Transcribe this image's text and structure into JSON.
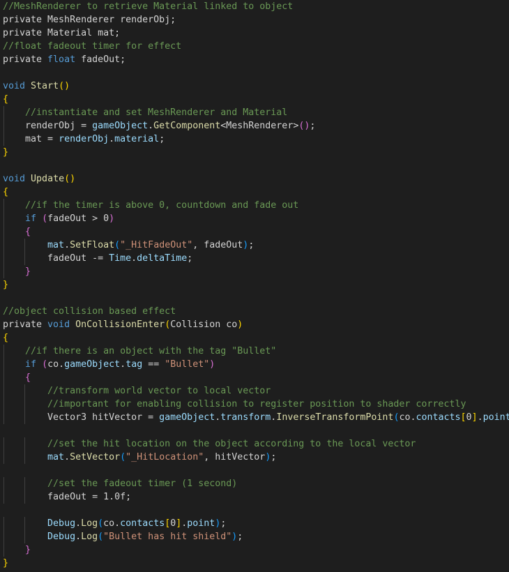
{
  "colors": {
    "background": "#1e1e1e",
    "default": "#d4d4d4",
    "comment": "#6a9955",
    "keyword": "#569cd6",
    "type": "#4ec9b0",
    "method": "#dcdcaa",
    "variable": "#9cdcfe",
    "string": "#ce9178",
    "number": "#b5cea8",
    "brace1": "#ffd700",
    "brace2": "#da70d6",
    "brace3": "#179fff"
  },
  "lines": [
    [
      [
        "comment",
        "//MeshRenderer to retrieve Material linked to object"
      ]
    ],
    [
      [
        "default",
        "private MeshRenderer renderObj;"
      ]
    ],
    [
      [
        "default",
        "private Material mat;"
      ]
    ],
    [
      [
        "comment",
        "//float fadeout timer for effect"
      ]
    ],
    [
      [
        "default",
        "private "
      ],
      [
        "keyword",
        "float"
      ],
      [
        "default",
        " fadeOut;"
      ]
    ],
    [],
    [
      [
        "keyword",
        "void"
      ],
      [
        "default",
        " "
      ],
      [
        "method",
        "Start"
      ],
      [
        "brace1",
        "()"
      ]
    ],
    [
      [
        "brace1",
        "{"
      ]
    ],
    [
      [
        "default",
        "    "
      ],
      [
        "comment",
        "//instantiate and set MeshRenderer and Material"
      ]
    ],
    [
      [
        "default",
        "    renderObj = "
      ],
      [
        "variable",
        "gameObject"
      ],
      [
        "default",
        "."
      ],
      [
        "method",
        "GetComponent"
      ],
      [
        "default",
        "<MeshRenderer>"
      ],
      [
        "brace2",
        "()"
      ],
      [
        "default",
        ";"
      ]
    ],
    [
      [
        "default",
        "    mat = "
      ],
      [
        "variable",
        "renderObj"
      ],
      [
        "default",
        "."
      ],
      [
        "variable",
        "material"
      ],
      [
        "default",
        ";"
      ]
    ],
    [
      [
        "brace1",
        "}"
      ]
    ],
    [],
    [
      [
        "keyword",
        "void"
      ],
      [
        "default",
        " "
      ],
      [
        "method",
        "Update"
      ],
      [
        "brace1",
        "()"
      ]
    ],
    [
      [
        "brace1",
        "{"
      ]
    ],
    [
      [
        "default",
        "    "
      ],
      [
        "comment",
        "//if the timer is above 0, countdown and fade out"
      ]
    ],
    [
      [
        "default",
        "    "
      ],
      [
        "keyword",
        "if"
      ],
      [
        "default",
        " "
      ],
      [
        "brace2",
        "("
      ],
      [
        "default",
        "fadeOut > 0"
      ],
      [
        "brace2",
        ")"
      ]
    ],
    [
      [
        "default",
        "    "
      ],
      [
        "brace2",
        "{"
      ]
    ],
    [
      [
        "default",
        "        "
      ],
      [
        "variable",
        "mat"
      ],
      [
        "default",
        "."
      ],
      [
        "method",
        "SetFloat"
      ],
      [
        "brace3",
        "("
      ],
      [
        "string",
        "\"_HitFadeOut\""
      ],
      [
        "default",
        ", fadeOut"
      ],
      [
        "brace3",
        ")"
      ],
      [
        "default",
        ";"
      ]
    ],
    [
      [
        "default",
        "        fadeOut -= "
      ],
      [
        "variable",
        "Time"
      ],
      [
        "default",
        "."
      ],
      [
        "variable",
        "deltaTime"
      ],
      [
        "default",
        ";"
      ]
    ],
    [
      [
        "default",
        "    "
      ],
      [
        "brace2",
        "}"
      ]
    ],
    [
      [
        "brace1",
        "}"
      ]
    ],
    [],
    [
      [
        "comment",
        "//object collision based effect"
      ]
    ],
    [
      [
        "default",
        "private "
      ],
      [
        "keyword",
        "void"
      ],
      [
        "default",
        " "
      ],
      [
        "method",
        "OnCollisionEnter"
      ],
      [
        "brace1",
        "("
      ],
      [
        "default",
        "Collision co"
      ],
      [
        "brace1",
        ")"
      ]
    ],
    [
      [
        "brace1",
        "{"
      ]
    ],
    [
      [
        "default",
        "    "
      ],
      [
        "comment",
        "//if there is an object with the tag \"Bullet\""
      ]
    ],
    [
      [
        "default",
        "    "
      ],
      [
        "keyword",
        "if"
      ],
      [
        "default",
        " "
      ],
      [
        "brace2",
        "("
      ],
      [
        "default",
        "co."
      ],
      [
        "variable",
        "gameObject"
      ],
      [
        "default",
        "."
      ],
      [
        "variable",
        "tag"
      ],
      [
        "default",
        " == "
      ],
      [
        "string",
        "\"Bullet\""
      ],
      [
        "brace2",
        ")"
      ]
    ],
    [
      [
        "default",
        "    "
      ],
      [
        "brace2",
        "{"
      ]
    ],
    [
      [
        "default",
        "        "
      ],
      [
        "comment",
        "//transform world vector to local vector"
      ]
    ],
    [
      [
        "default",
        "        "
      ],
      [
        "comment",
        "//important for enabling collision to register position to shader correctly"
      ]
    ],
    [
      [
        "default",
        "        Vector3 hitVector = "
      ],
      [
        "variable",
        "gameObject"
      ],
      [
        "default",
        "."
      ],
      [
        "variable",
        "transform"
      ],
      [
        "default",
        "."
      ],
      [
        "method",
        "InverseTransformPoint"
      ],
      [
        "brace3",
        "("
      ],
      [
        "default",
        "co."
      ],
      [
        "variable",
        "contacts"
      ],
      [
        "brace1",
        "["
      ],
      [
        "default",
        "0"
      ],
      [
        "brace1",
        "]"
      ],
      [
        "default",
        "."
      ],
      [
        "variable",
        "point"
      ],
      [
        "brace3",
        ")"
      ],
      [
        "default",
        ";"
      ]
    ],
    [],
    [
      [
        "default",
        "        "
      ],
      [
        "comment",
        "//set the hit location on the object according to the local vector"
      ]
    ],
    [
      [
        "default",
        "        "
      ],
      [
        "variable",
        "mat"
      ],
      [
        "default",
        "."
      ],
      [
        "method",
        "SetVector"
      ],
      [
        "brace3",
        "("
      ],
      [
        "string",
        "\"_HitLocation\""
      ],
      [
        "default",
        ", hitVector"
      ],
      [
        "brace3",
        ")"
      ],
      [
        "default",
        ";"
      ]
    ],
    [],
    [
      [
        "default",
        "        "
      ],
      [
        "comment",
        "//set the fadeout timer (1 second)"
      ]
    ],
    [
      [
        "default",
        "        fadeOut = 1.0f;"
      ]
    ],
    [],
    [
      [
        "default",
        "        "
      ],
      [
        "variable",
        "Debug"
      ],
      [
        "default",
        "."
      ],
      [
        "method",
        "Log"
      ],
      [
        "brace3",
        "("
      ],
      [
        "default",
        "co."
      ],
      [
        "variable",
        "contacts"
      ],
      [
        "brace1",
        "["
      ],
      [
        "default",
        "0"
      ],
      [
        "brace1",
        "]"
      ],
      [
        "default",
        "."
      ],
      [
        "variable",
        "point"
      ],
      [
        "brace3",
        ")"
      ],
      [
        "default",
        ";"
      ]
    ],
    [
      [
        "default",
        "        "
      ],
      [
        "variable",
        "Debug"
      ],
      [
        "default",
        "."
      ],
      [
        "method",
        "Log"
      ],
      [
        "brace3",
        "("
      ],
      [
        "string",
        "\"Bullet has hit shield\""
      ],
      [
        "brace3",
        ")"
      ],
      [
        "default",
        ";"
      ]
    ],
    [
      [
        "default",
        "    "
      ],
      [
        "brace2",
        "}"
      ]
    ],
    [
      [
        "brace1",
        "}"
      ]
    ]
  ]
}
